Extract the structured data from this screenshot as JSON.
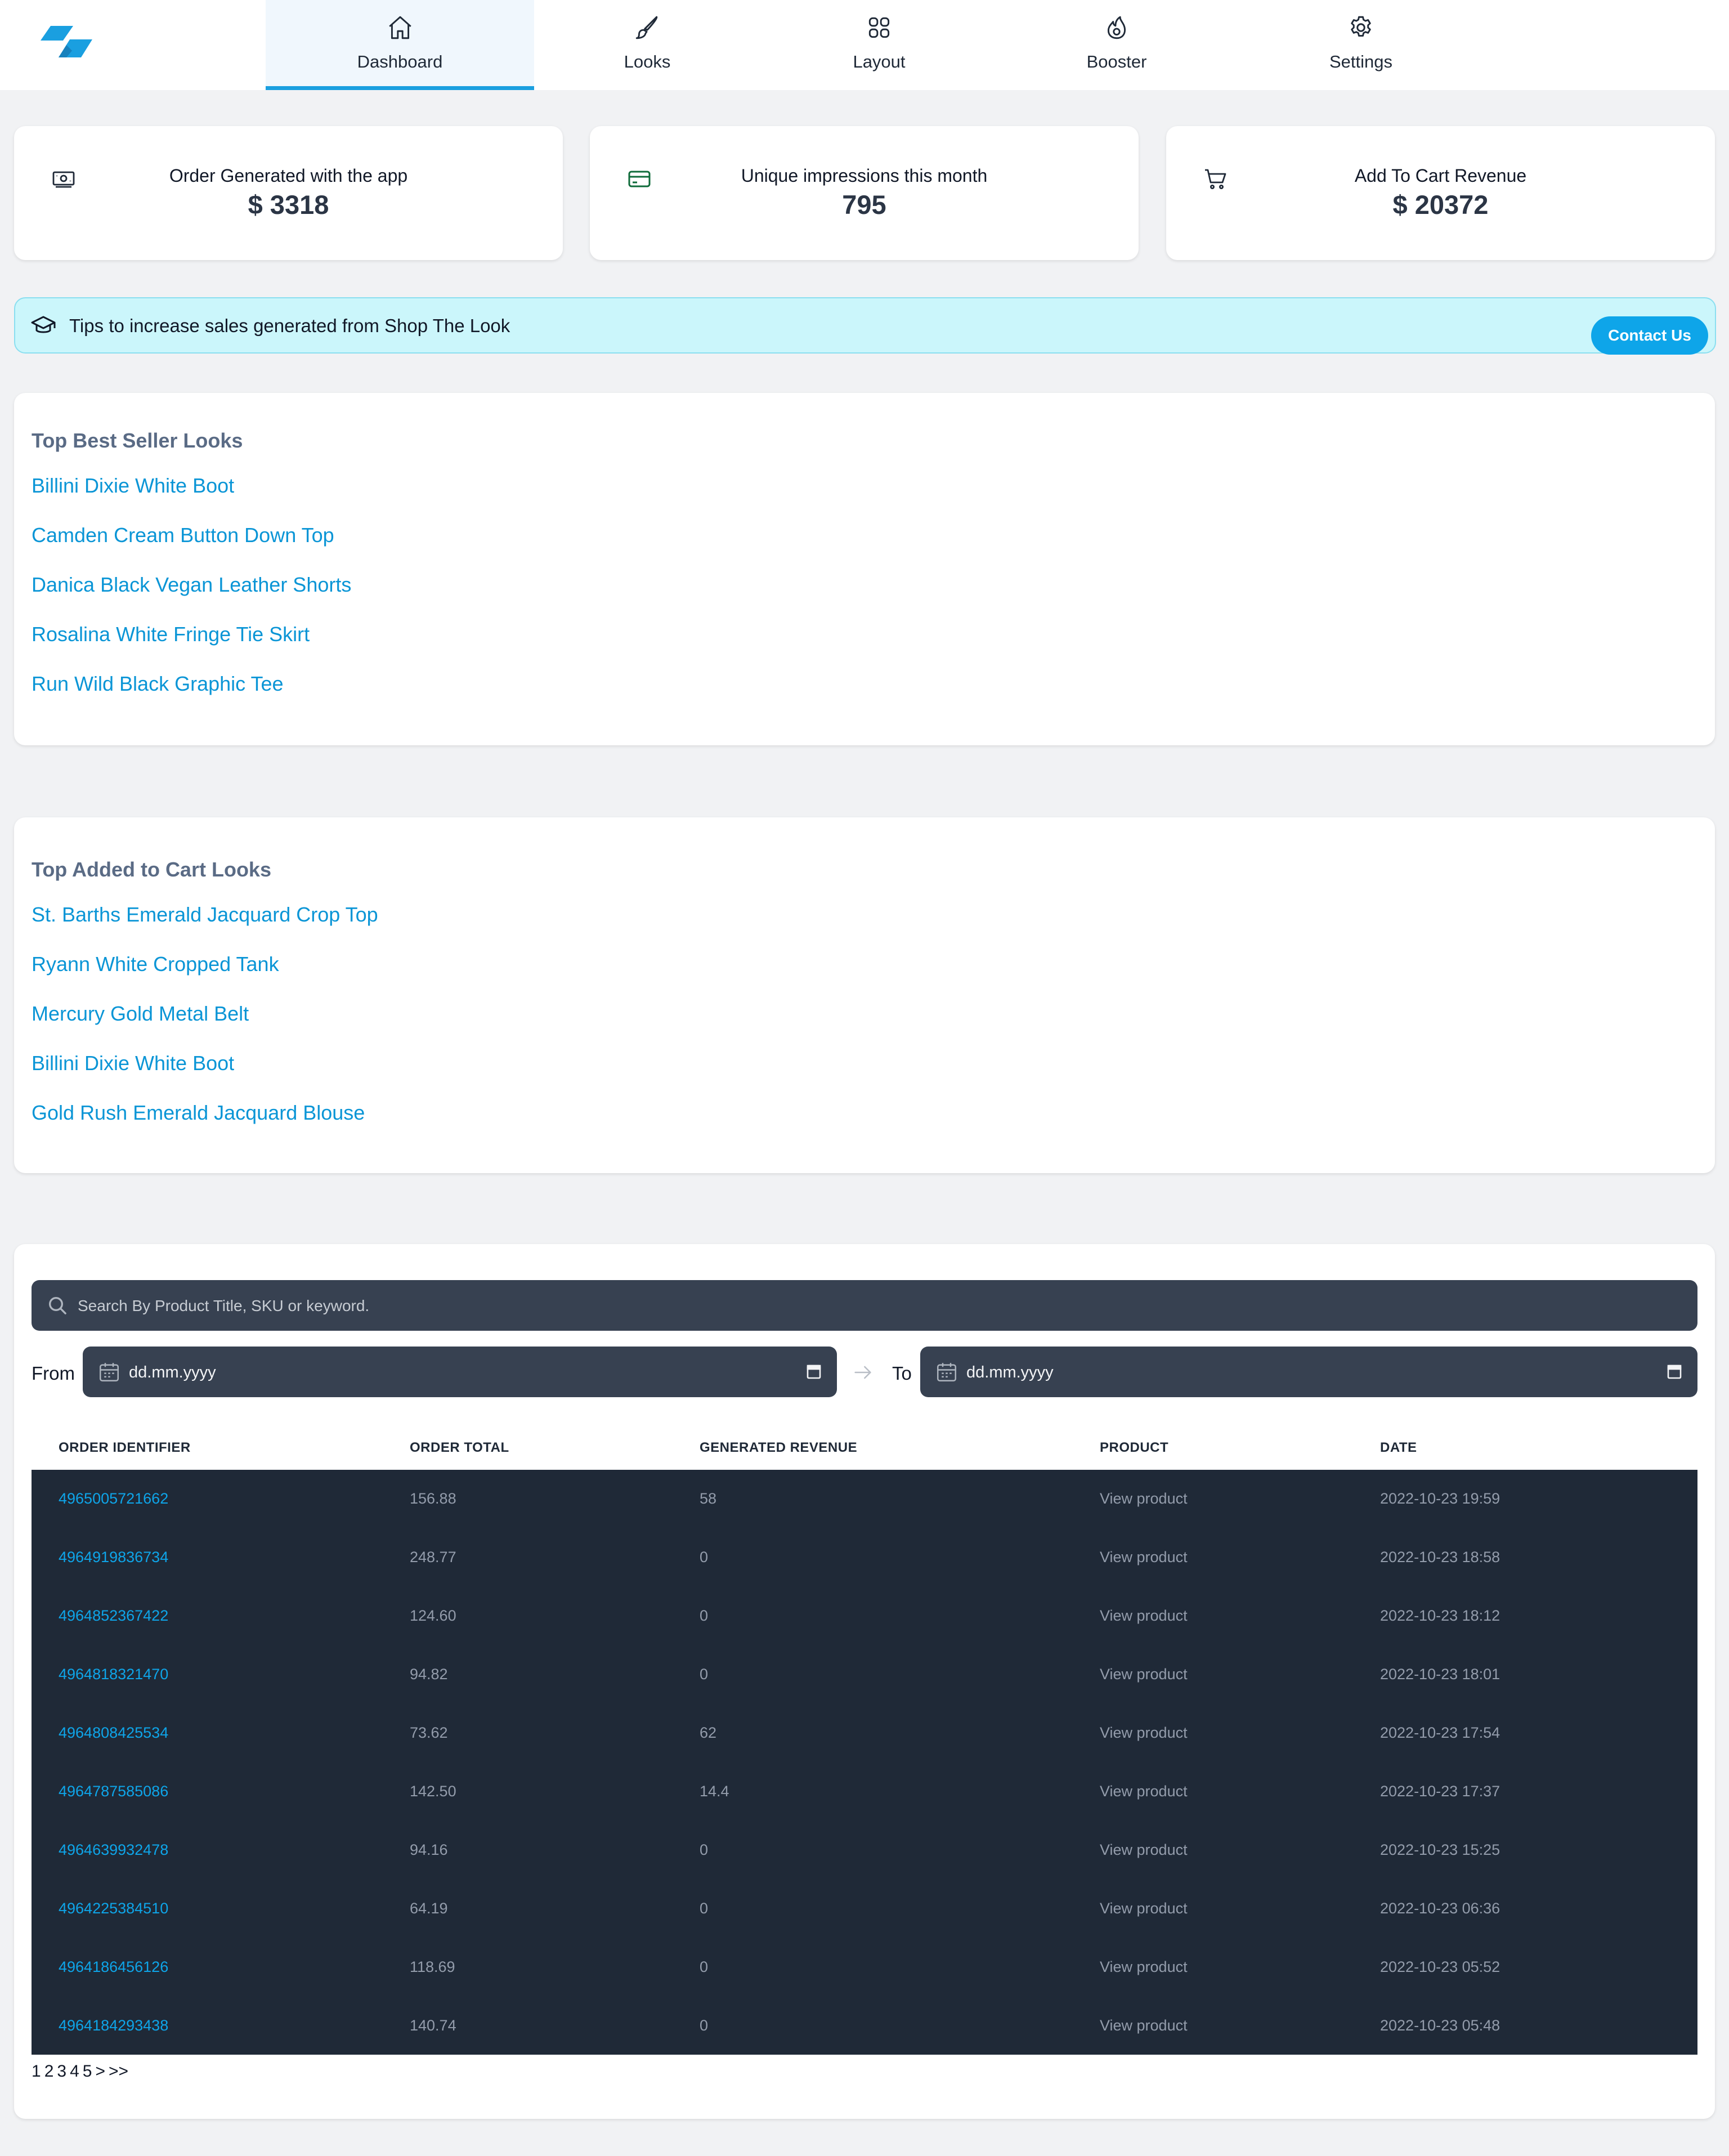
{
  "nav": {
    "tabs": [
      {
        "label": "Dashboard",
        "icon": "home-icon",
        "active": true
      },
      {
        "label": "Looks",
        "icon": "brush-icon",
        "active": false
      },
      {
        "label": "Layout",
        "icon": "grid-icon",
        "active": false
      },
      {
        "label": "Booster",
        "icon": "flame-icon",
        "active": false
      },
      {
        "label": "Settings",
        "icon": "gear-icon",
        "active": false
      }
    ]
  },
  "stats": [
    {
      "title": "Order Generated with the app",
      "value": "$ 3318",
      "icon": "money-icon"
    },
    {
      "title": "Unique impressions this month",
      "value": "795",
      "icon": "credit-card-icon"
    },
    {
      "title": "Add To Cart Revenue",
      "value": "$ 20372",
      "icon": "cart-icon"
    }
  ],
  "tips": {
    "text": "Tips to increase sales generated from Shop The Look",
    "button": "Contact Us",
    "icon": "graduation-cap-icon"
  },
  "best_sellers": {
    "title": "Top Best Seller Looks",
    "items": [
      "Billini Dixie White Boot",
      "Camden Cream Button Down Top",
      "Danica Black Vegan Leather Shorts",
      "Rosalina White Fringe Tie Skirt",
      "Run Wild Black Graphic Tee"
    ]
  },
  "added_to_cart": {
    "title": "Top Added to Cart Looks",
    "items": [
      "St. Barths Emerald Jacquard Crop Top",
      "Ryann White Cropped Tank",
      "Mercury Gold Metal Belt",
      "Billini Dixie White Boot",
      "Gold Rush Emerald Jacquard Blouse"
    ]
  },
  "orders": {
    "search_placeholder": "Search By Product Title, SKU or keyword.",
    "from_label": "From",
    "to_label": "To",
    "from_value": "dd.mm.yyyy",
    "to_value": "dd.mm.yyyy",
    "columns": [
      "ORDER IDENTIFIER",
      "ORDER TOTAL",
      "GENERATED REVENUE",
      "PRODUCT",
      "DATE"
    ],
    "rows": [
      [
        "4965005721662",
        "156.88",
        "58",
        "View product",
        "2022-10-23 19:59"
      ],
      [
        "4964919836734",
        "248.77",
        "0",
        "View product",
        "2022-10-23 18:58"
      ],
      [
        "4964852367422",
        "124.60",
        "0",
        "View product",
        "2022-10-23 18:12"
      ],
      [
        "4964818321470",
        "94.82",
        "0",
        "View product",
        "2022-10-23 18:01"
      ],
      [
        "4964808425534",
        "73.62",
        "62",
        "View product",
        "2022-10-23 17:54"
      ],
      [
        "4964787585086",
        "142.50",
        "14.4",
        "View product",
        "2022-10-23 17:37"
      ],
      [
        "4964639932478",
        "94.16",
        "0",
        "View product",
        "2022-10-23 15:25"
      ],
      [
        "4964225384510",
        "64.19",
        "0",
        "View product",
        "2022-10-23 06:36"
      ],
      [
        "4964186456126",
        "118.69",
        "0",
        "View product",
        "2022-10-23 05:52"
      ],
      [
        "4964184293438",
        "140.74",
        "0",
        "View product",
        "2022-10-23 05:48"
      ]
    ],
    "pagination": [
      "1",
      "2",
      "3",
      "4",
      "5",
      ">",
      ">>"
    ]
  },
  "colors": {
    "accent": "#0ea5e9",
    "link": "#0a95d6",
    "table_bg": "#1f2937",
    "input_bg": "#374151",
    "tips_bg": "#cbf6fb"
  }
}
